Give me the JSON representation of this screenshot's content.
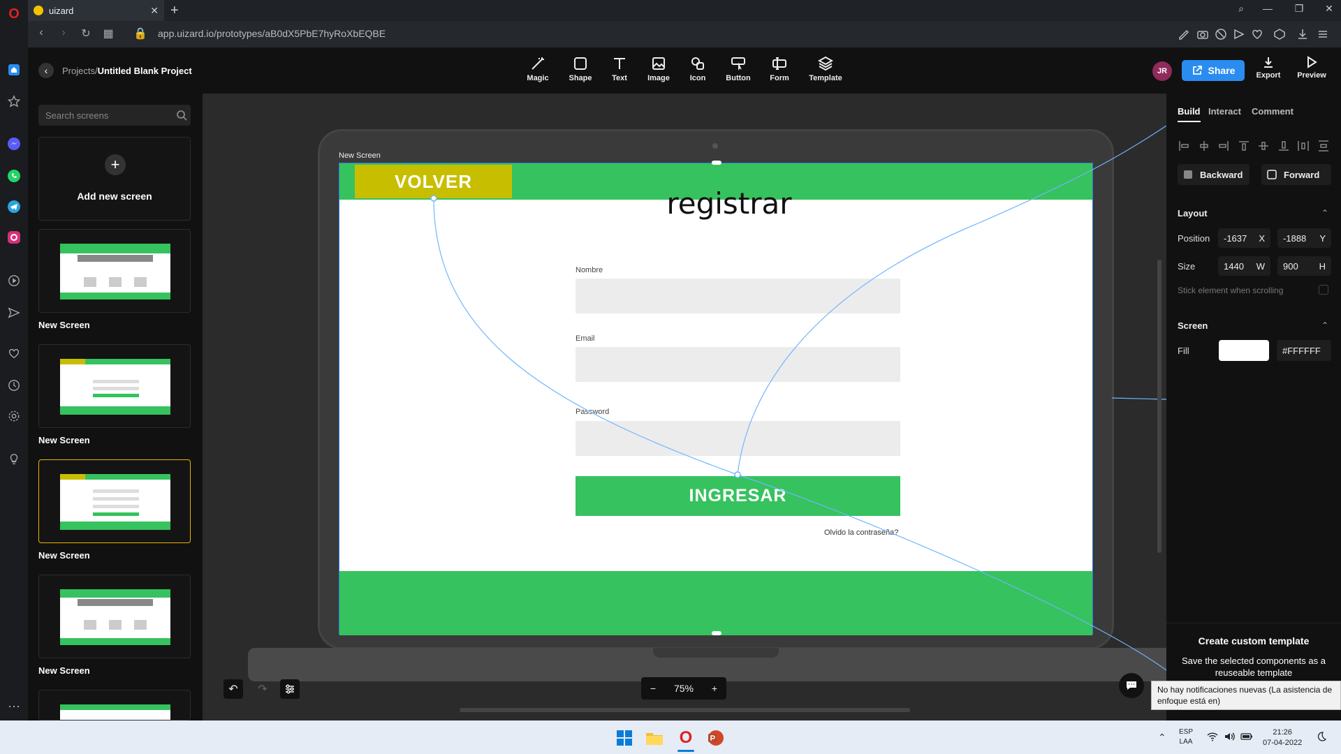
{
  "browser": {
    "tab_title": "uizard",
    "url": "app.uizard.io/prototypes/aB0dX5PbE7hyRoXbEQBE"
  },
  "header": {
    "breadcrumb_parent": "Projects",
    "breadcrumb_sep": "/",
    "project_name": "Untitled Blank Project",
    "tools": [
      "Magic",
      "Shape",
      "Text",
      "Image",
      "Icon",
      "Button",
      "Form",
      "Template"
    ],
    "avatar_initials": "JR",
    "share_label": "Share",
    "export_label": "Export",
    "preview_label": "Preview"
  },
  "left_panel": {
    "search_placeholder": "Search screens",
    "add_screen_label": "Add new screen",
    "screens": [
      {
        "label": "New Screen"
      },
      {
        "label": "New Screen"
      },
      {
        "label": "New Screen",
        "selected": true
      },
      {
        "label": "New Screen"
      }
    ]
  },
  "canvas": {
    "frame_label": "New Screen",
    "back_button": "VOLVER",
    "title": "registrar",
    "fields": [
      "Nombre",
      "Email",
      "Password"
    ],
    "submit_button": "INGRESAR",
    "forgot_link": "Olvido la contraseña?",
    "zoom": "75%"
  },
  "right_panel": {
    "tabs": [
      "Build",
      "Interact",
      "Comment"
    ],
    "backward_label": "Backward",
    "forward_label": "Forward",
    "layout_title": "Layout",
    "position_label": "Position",
    "pos_x": "-1637",
    "pos_x_axis": "X",
    "pos_y": "-1888",
    "pos_y_axis": "Y",
    "size_label": "Size",
    "size_w": "1440",
    "size_w_axis": "W",
    "size_h": "900",
    "size_h_axis": "H",
    "stick_label": "Stick element when scrolling",
    "screen_title": "Screen",
    "fill_label": "Fill",
    "fill_value": "#FFFFFF",
    "template_title": "Create custom template",
    "template_desc": "Save the selected components as a reuseable template"
  },
  "notification": {
    "text": "No hay notificaciones nuevas  (La asistencia de enfoque está en)"
  },
  "taskbar": {
    "lang_top": "ESP",
    "lang_bottom": "LAA",
    "time": "21:26",
    "date": "07-04-2022"
  },
  "colors": {
    "brand_green": "#36c25e",
    "volver_yellow": "#c8be00",
    "share_blue": "#2a8cf0",
    "selection_blue": "#2a7ce0"
  }
}
